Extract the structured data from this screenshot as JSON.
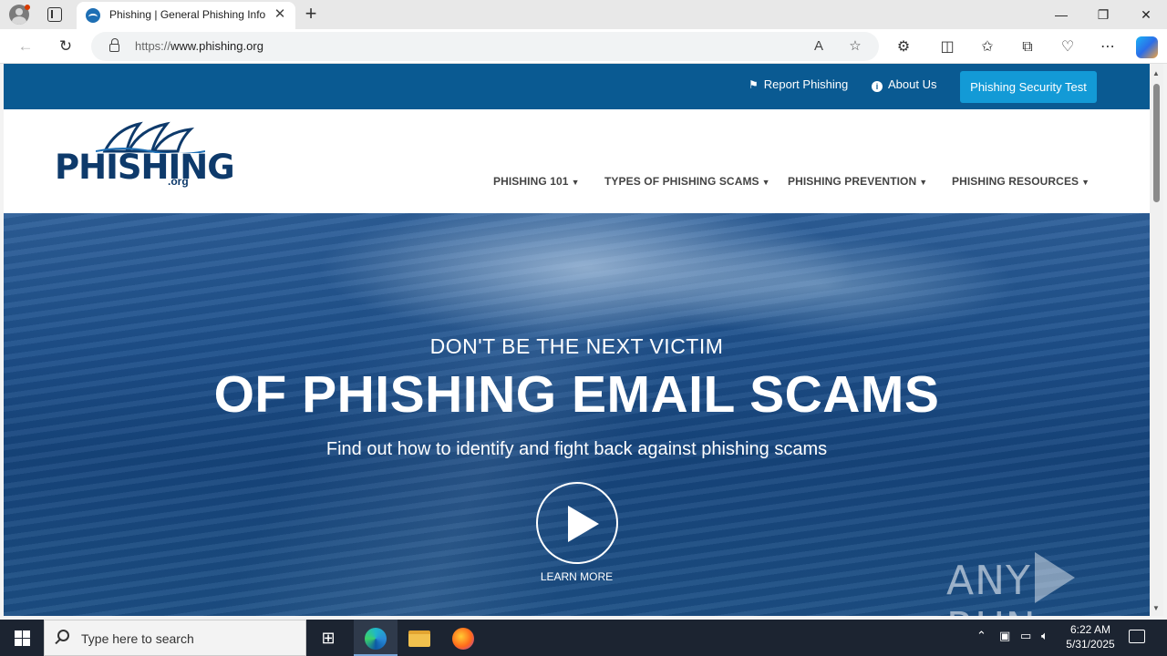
{
  "browser": {
    "tab_title": "Phishing | General Phishing Infor",
    "tab_close": "✕",
    "new_tab": "+",
    "url_prefix": "https://",
    "url_host": "www.phishing.org",
    "window_minimize": "—",
    "window_restore": "❐",
    "window_close": "✕"
  },
  "site": {
    "top_links": [
      {
        "label": "Report Phishing"
      },
      {
        "label": "About Us"
      }
    ],
    "cta_button": "Phishing Security Test",
    "logo_word": "PHISHING",
    "logo_suffix": ".org",
    "menu": [
      {
        "label": "PHISHING 101"
      },
      {
        "label": "TYPES OF PHISHING SCAMS"
      },
      {
        "label": "PHISHING PREVENTION"
      },
      {
        "label": "PHISHING RESOURCES"
      }
    ],
    "hero": {
      "pretitle": "DON'T BE THE NEXT VICTIM",
      "title": "OF PHISHING EMAIL SCAMS",
      "subtitle": "Find out how to identify and fight back against phishing scams",
      "cta": "LEARN MORE"
    }
  },
  "watermark": {
    "left": "ANY",
    "right": "RUN"
  },
  "taskbar": {
    "search_placeholder": "Type here to search",
    "time": "6:22 AM",
    "date": "5/31/2025"
  },
  "colors": {
    "top_strip": "#0a5a92",
    "cta": "#139ad6",
    "logo": "#0e3a6b"
  }
}
